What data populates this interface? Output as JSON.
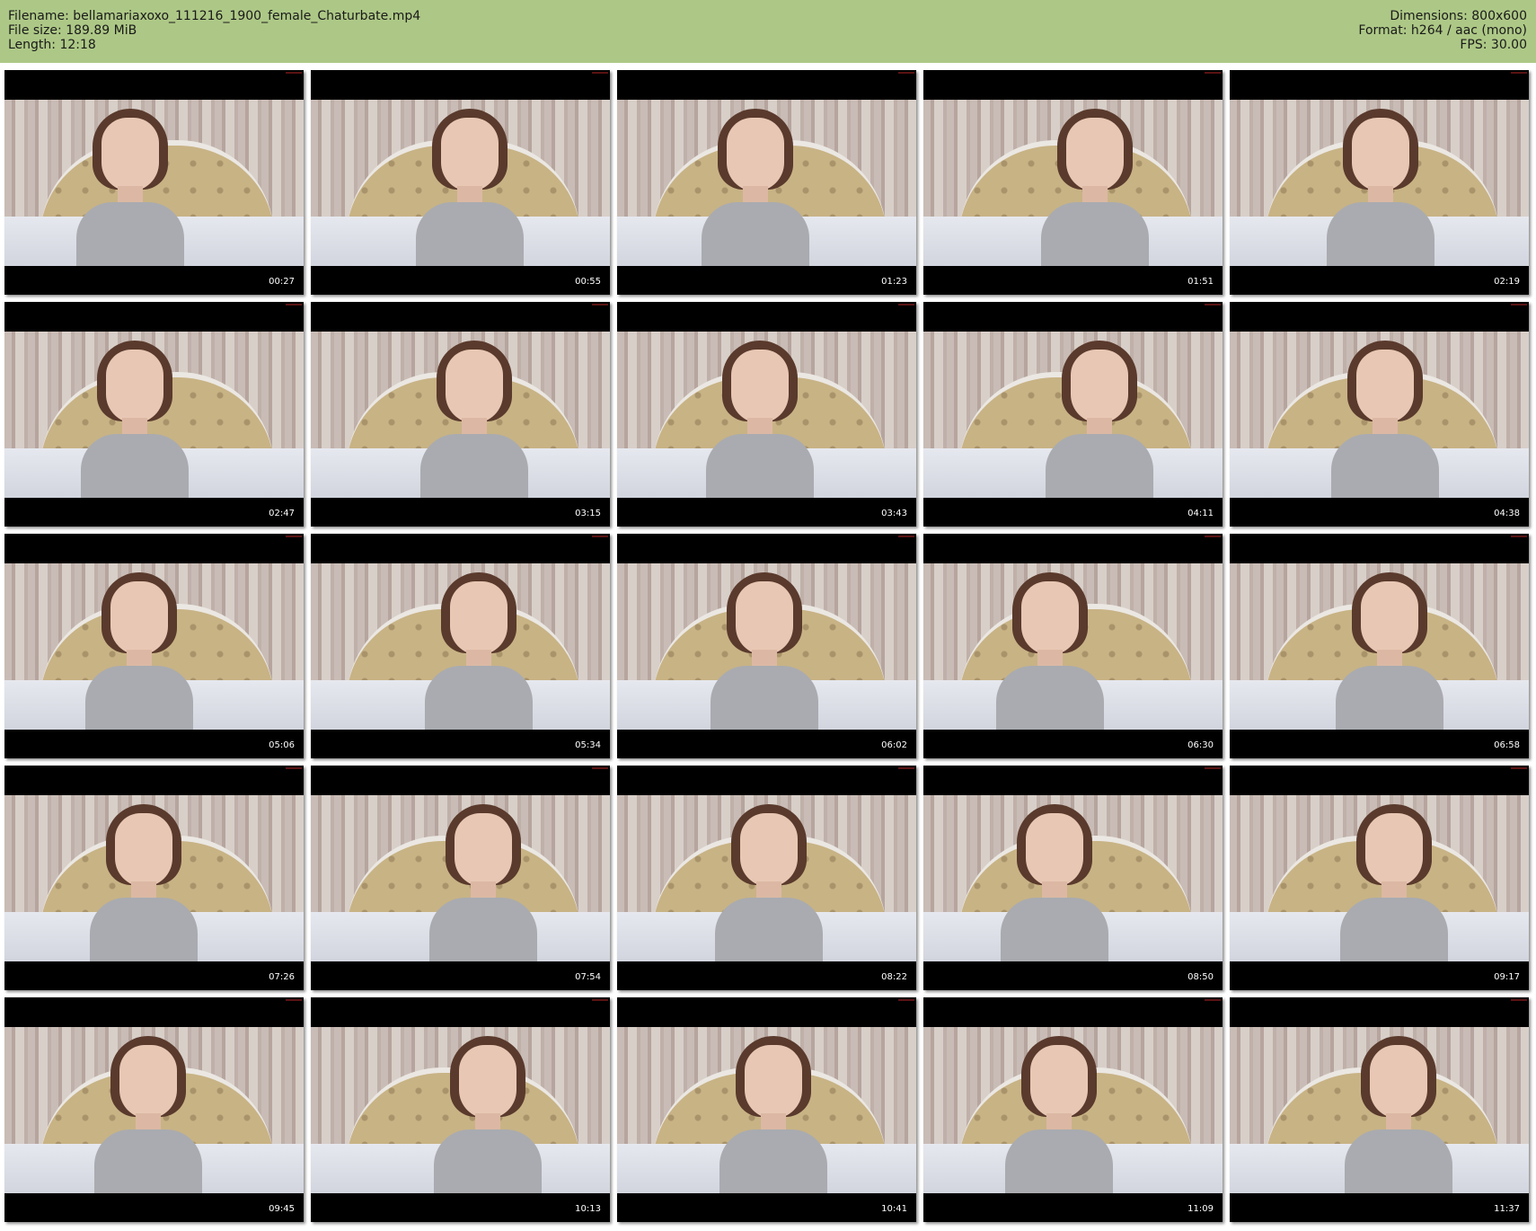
{
  "info": {
    "filename": "Filename: bellamariaxoxo_111216_1900_female_Chaturbate.mp4",
    "file_size": "File size: 189.89 MiB",
    "length": "Length: 12:18",
    "dimensions": "Dimensions: 800x600",
    "format": "Format: h264 / aac (mono)",
    "fps": "FPS: 30.00"
  },
  "colors": {
    "header_background": "#adc886",
    "thumbnail_background": "#000000",
    "timestamp_text": "#ffffff"
  },
  "thumbnails": [
    {
      "timestamp": "00:27"
    },
    {
      "timestamp": "00:55"
    },
    {
      "timestamp": "01:23"
    },
    {
      "timestamp": "01:51"
    },
    {
      "timestamp": "02:19"
    },
    {
      "timestamp": "02:47"
    },
    {
      "timestamp": "03:15"
    },
    {
      "timestamp": "03:43"
    },
    {
      "timestamp": "04:11"
    },
    {
      "timestamp": "04:38"
    },
    {
      "timestamp": "05:06"
    },
    {
      "timestamp": "05:34"
    },
    {
      "timestamp": "06:02"
    },
    {
      "timestamp": "06:30"
    },
    {
      "timestamp": "06:58"
    },
    {
      "timestamp": "07:26"
    },
    {
      "timestamp": "07:54"
    },
    {
      "timestamp": "08:22"
    },
    {
      "timestamp": "08:50"
    },
    {
      "timestamp": "09:17"
    },
    {
      "timestamp": "09:45"
    },
    {
      "timestamp": "10:13"
    },
    {
      "timestamp": "10:41"
    },
    {
      "timestamp": "11:09"
    },
    {
      "timestamp": "11:37"
    }
  ]
}
